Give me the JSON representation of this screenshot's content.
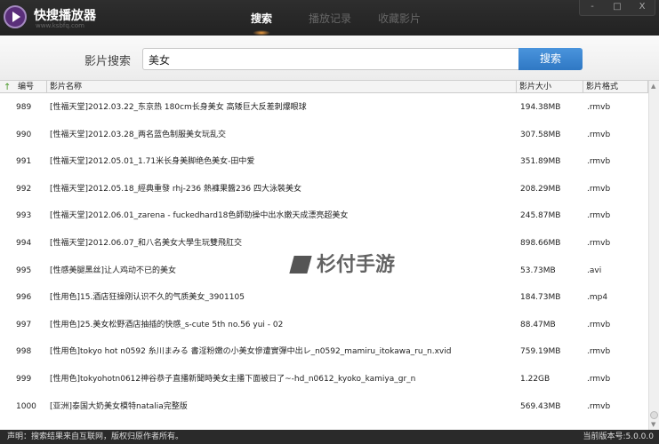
{
  "app": {
    "name": "快搜播放器",
    "url": "www.ksbfq.com"
  },
  "tabs": [
    {
      "label": "搜索",
      "active": true
    },
    {
      "label": "播放记录"
    },
    {
      "label": "收藏影片"
    }
  ],
  "window_controls": {
    "minimize": "-",
    "maximize": "□",
    "close": "X"
  },
  "search": {
    "label": "影片搜索",
    "value": "美女",
    "button": "搜索"
  },
  "columns": [
    "编号",
    "影片名称",
    "影片大小",
    "影片格式"
  ],
  "rows": [
    {
      "id": "989",
      "name": "[性福天堂]2012.03.22_东京热 180cm长身美女 高矮巨大反差刺爆眼球",
      "size": "194.38MB",
      "format": ".rmvb"
    },
    {
      "id": "990",
      "name": "[性福天堂]2012.03.28_两名蓝色制服美女玩乱交",
      "size": "307.58MB",
      "format": ".rmvb"
    },
    {
      "id": "991",
      "name": "[性福天堂]2012.05.01_1.71米长身美脚绝色美女-田中爱",
      "size": "351.89MB",
      "format": ".rmvb"
    },
    {
      "id": "992",
      "name": "[性福天堂]2012.05.18_經典重發 rhj-236 熱褲果醬236 四大泳裝美女",
      "size": "208.29MB",
      "format": ".rmvb"
    },
    {
      "id": "993",
      "name": "[性福天堂]2012.06.01_zarena - fuckedhard18色師勁操中出水嫩天成漂亮超美女",
      "size": "245.87MB",
      "format": ".rmvb"
    },
    {
      "id": "994",
      "name": "[性福天堂]2012.06.07_和八名美女大學生玩雙飛肛交",
      "size": "898.66MB",
      "format": ".rmvb"
    },
    {
      "id": "995",
      "name": "[性感美腿黑丝]让人鸡动不已的美女",
      "size": "53.73MB",
      "format": ".avi"
    },
    {
      "id": "996",
      "name": "[性用色]15.酒店狂操刚认识不久的气质美女_3901105",
      "size": "184.73MB",
      "format": ".mp4"
    },
    {
      "id": "997",
      "name": "[性用色]25.美女松野酒店抽插的快感_s-cute 5th no.56 yui - 02",
      "size": "88.47MB",
      "format": ".rmvb"
    },
    {
      "id": "998",
      "name": "[性用色]tokyo hot n0592 糸川まみる 書淫粉嫩の小美女慘遭實彈中出レ_n0592_mamiru_itokawa_ru_n.xvid",
      "size": "759.19MB",
      "format": ".rmvb"
    },
    {
      "id": "999",
      "name": "[性用色]tokyohotn0612神谷恭子直播新聞時美女主播下面被日了~-hd_n0612_kyoko_kamiya_gr_n",
      "size": "1.22GB",
      "format": ".rmvb"
    },
    {
      "id": "1000",
      "name": "[亚洲]泰国大奶美女模特natalia完整版",
      "size": "569.43MB",
      "format": ".rmvb"
    }
  ],
  "footer": {
    "notice": "声明：搜索结果来自互联网，版权归原作者所有。",
    "version": "当前版本号:5.0.0.0"
  },
  "watermark": "杉付手游",
  "colors": {
    "titlebar": "#2b2b2b",
    "accent": "#3a85d0",
    "active_glow": "#f5a040"
  }
}
